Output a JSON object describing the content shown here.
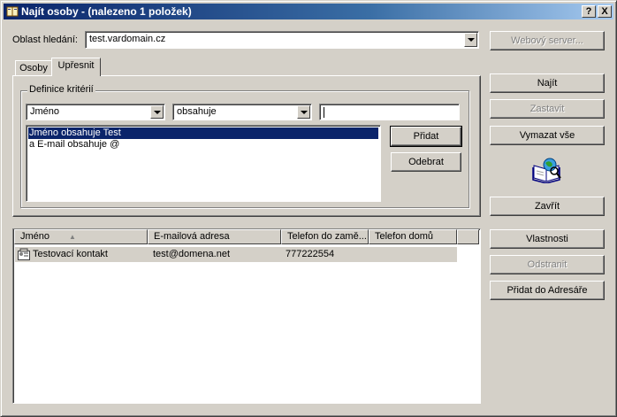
{
  "window": {
    "title": "Najít osoby - (nalezeno 1 položek)",
    "help_label": "?",
    "close_label": "X"
  },
  "search_area": {
    "label": "Oblast hledání:",
    "value": "test.vardomain.cz",
    "web_server_label": "Webový server..."
  },
  "tabs": [
    {
      "label": "Osoby"
    },
    {
      "label": "Upřesnit"
    }
  ],
  "criteria": {
    "group_title": "Definice kritérií",
    "field_value": "Jméno",
    "operator_value": "obsahuje",
    "text_value": "",
    "items": [
      {
        "label": "Jméno obsahuje Test",
        "selected": true
      },
      {
        "label": "a E-mail obsahuje @",
        "selected": false
      }
    ],
    "add_label": "Přidat",
    "remove_label": "Odebrat"
  },
  "actions": {
    "find": "Najít",
    "stop": "Zastavit",
    "clear_all": "Vymazat vše",
    "close": "Zavřít",
    "properties": "Vlastnosti",
    "delete": "Odstranit",
    "add_to_address_book": "Přidat do Adresáře"
  },
  "results": {
    "columns": [
      "Jméno",
      "E-mailová adresa",
      "Telefon do zamě...",
      "Telefon domů"
    ],
    "rows": [
      {
        "name": "Testovací kontakt",
        "email": "test@domena.net",
        "work_phone": "777222554",
        "home_phone": ""
      }
    ]
  },
  "colors": {
    "title_start": "#0a246a",
    "title_end": "#a6caf0",
    "selection": "#0a246a",
    "face": "#d4d0c8"
  }
}
